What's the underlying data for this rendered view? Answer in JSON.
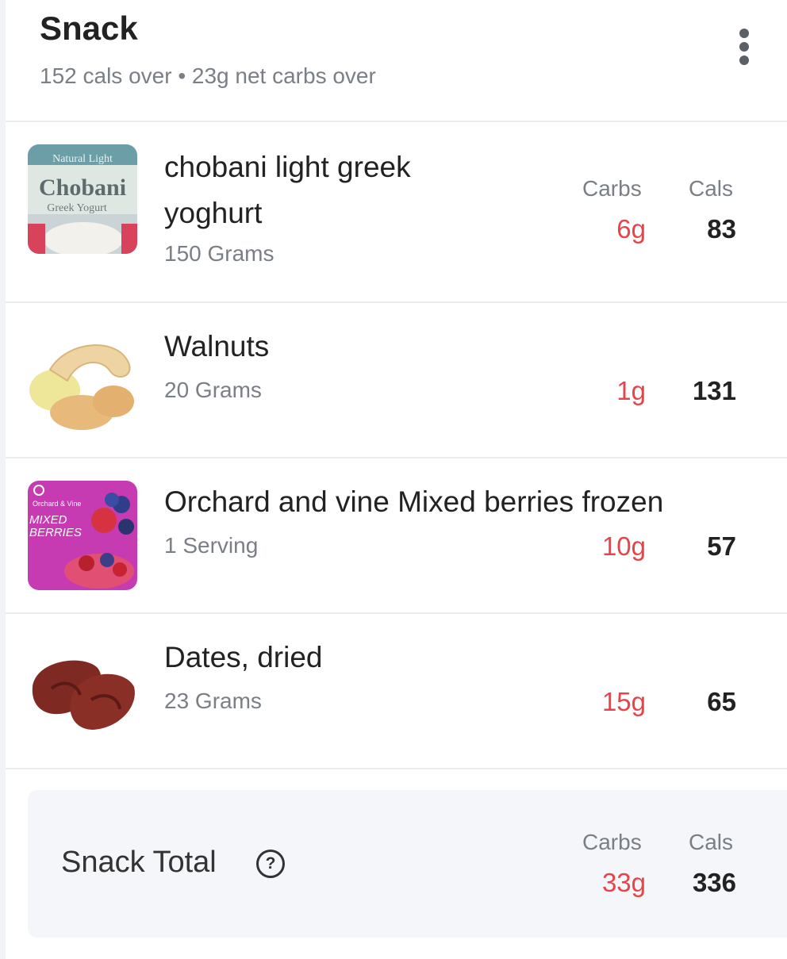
{
  "header": {
    "title": "Snack",
    "subtitle": "152 cals over • 23g net carbs over",
    "menu_icon": "more-vertical-icon"
  },
  "columns": {
    "carbs": "Carbs",
    "cals": "Cals"
  },
  "items": [
    {
      "name_line1": "chobani light greek",
      "name_line2": "yoghurt",
      "quantity": "150 Grams",
      "carbs": "6g",
      "cals": "83",
      "image": "chobani-yogurt-image"
    },
    {
      "name": "Walnuts",
      "quantity": "20 Grams",
      "carbs": "1g",
      "cals": "131",
      "image": "nuts-image"
    },
    {
      "name": "Orchard and vine Mixed berries frozen",
      "quantity": "1 Serving",
      "carbs": "10g",
      "cals": "57",
      "image": "mixed-berries-image",
      "package_text": {
        "brand": "Orchard & Vine",
        "product_line1": "MIXED",
        "product_line2": "BERRIES"
      }
    },
    {
      "name": "Dates, dried",
      "quantity": "23 Grams",
      "carbs": "15g",
      "cals": "65",
      "image": "dates-image"
    }
  ],
  "yogurt_label": {
    "top": "Natural Light",
    "brand": "Chobani",
    "type": "Greek Yogurt"
  },
  "total": {
    "label": "Snack Total",
    "carbs": "33g",
    "cals": "336",
    "help_icon": "help-circle-icon"
  },
  "colors": {
    "carbs": "#e8434a",
    "muted": "#7a7f86",
    "total_bg": "#f4f6f9"
  }
}
